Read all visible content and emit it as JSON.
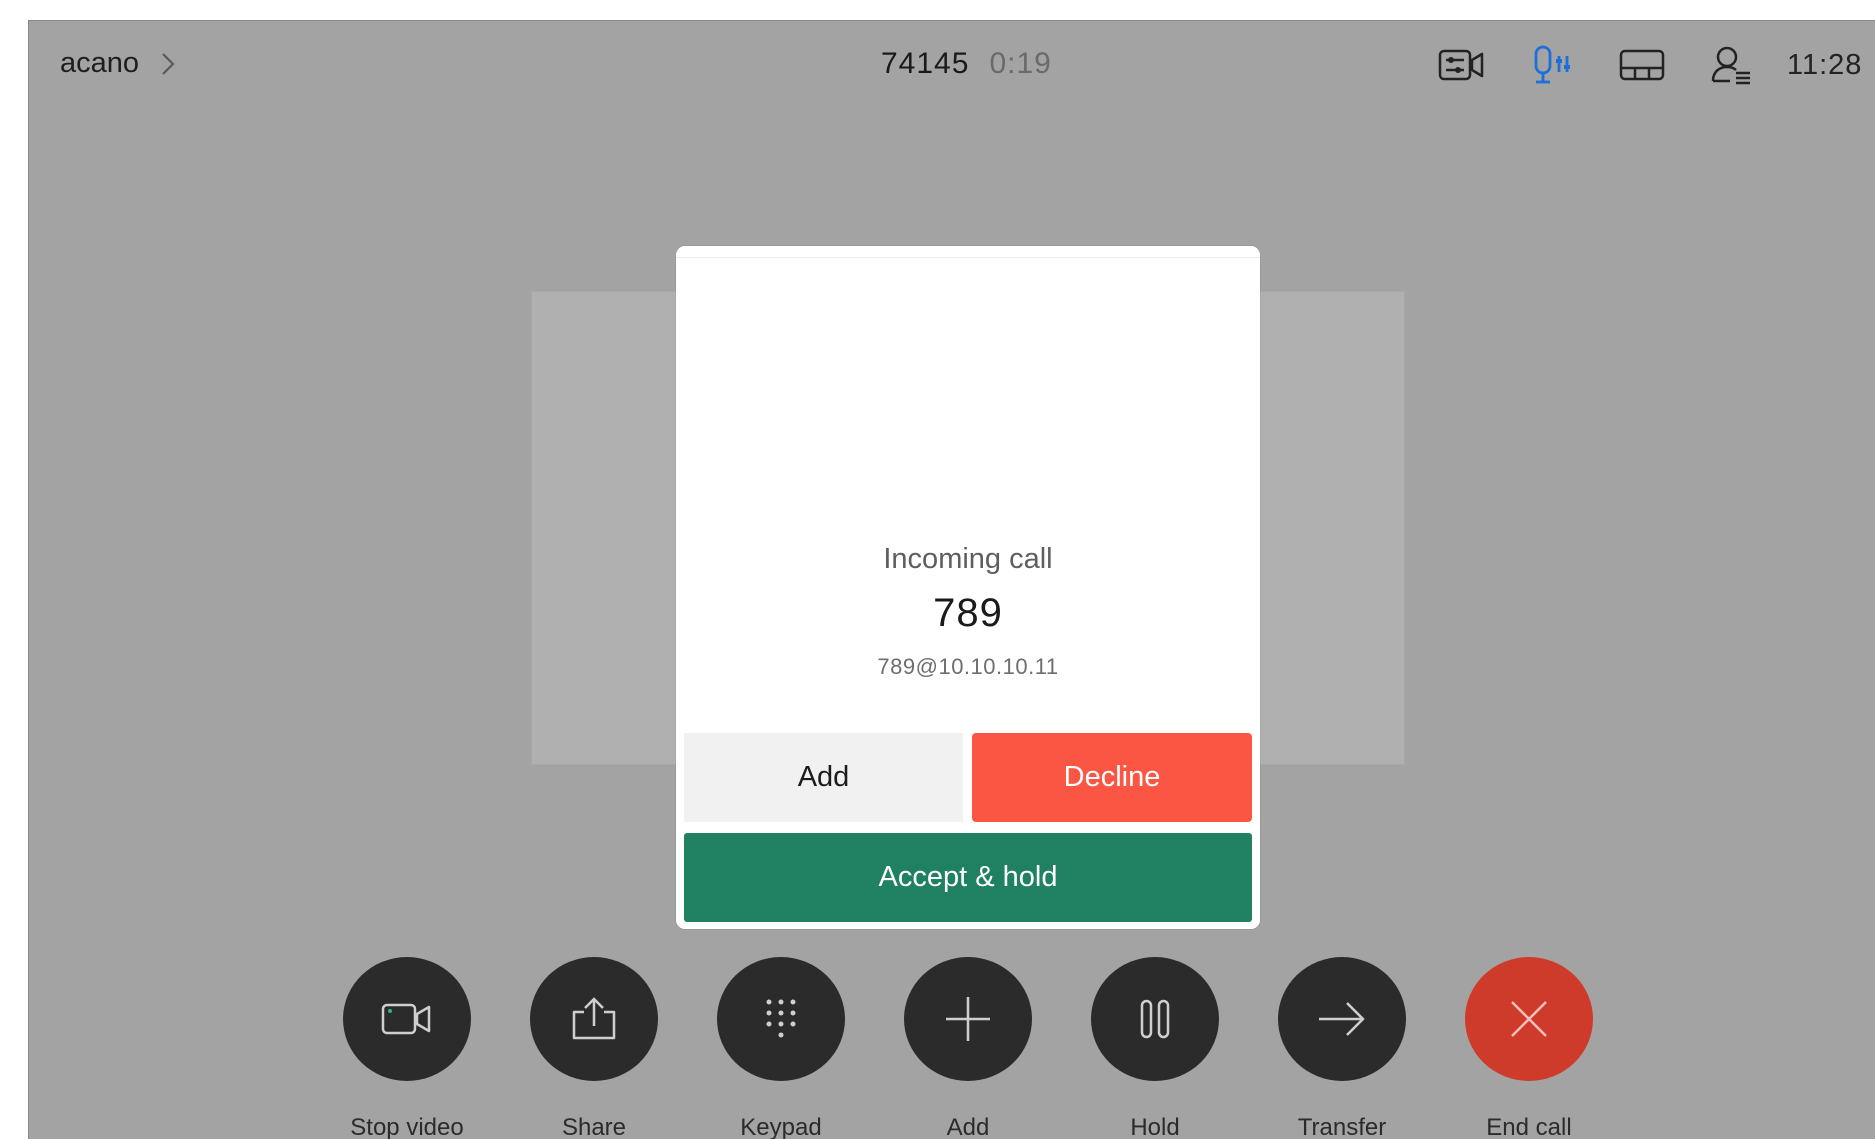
{
  "topbar": {
    "breadcrumb": "acano",
    "call_number": "74145",
    "call_timer": "0:19",
    "clock": "11:28",
    "status_icons": [
      "camera-settings-icon",
      "microphone-settings-icon",
      "layout-icon",
      "participants-icon"
    ],
    "accent_color": "#1e6fd9"
  },
  "incoming_call": {
    "title": "Incoming call",
    "caller_name": "789",
    "caller_uri": "789@10.10.10.11",
    "add_label": "Add",
    "decline_label": "Decline",
    "accept_hold_label": "Accept & hold",
    "decline_color": "#fb5643",
    "accept_color": "#1f8162"
  },
  "controls": [
    {
      "label": "Stop video",
      "icon": "video-camera-icon"
    },
    {
      "label": "Share",
      "icon": "share-icon"
    },
    {
      "label": "Keypad",
      "icon": "keypad-icon"
    },
    {
      "label": "Add",
      "icon": "plus-icon"
    },
    {
      "label": "Hold",
      "icon": "pause-icon"
    },
    {
      "label": "Transfer",
      "icon": "arrow-right-icon"
    },
    {
      "label": "End call",
      "icon": "close-icon",
      "color": "#cf3b2a"
    }
  ]
}
